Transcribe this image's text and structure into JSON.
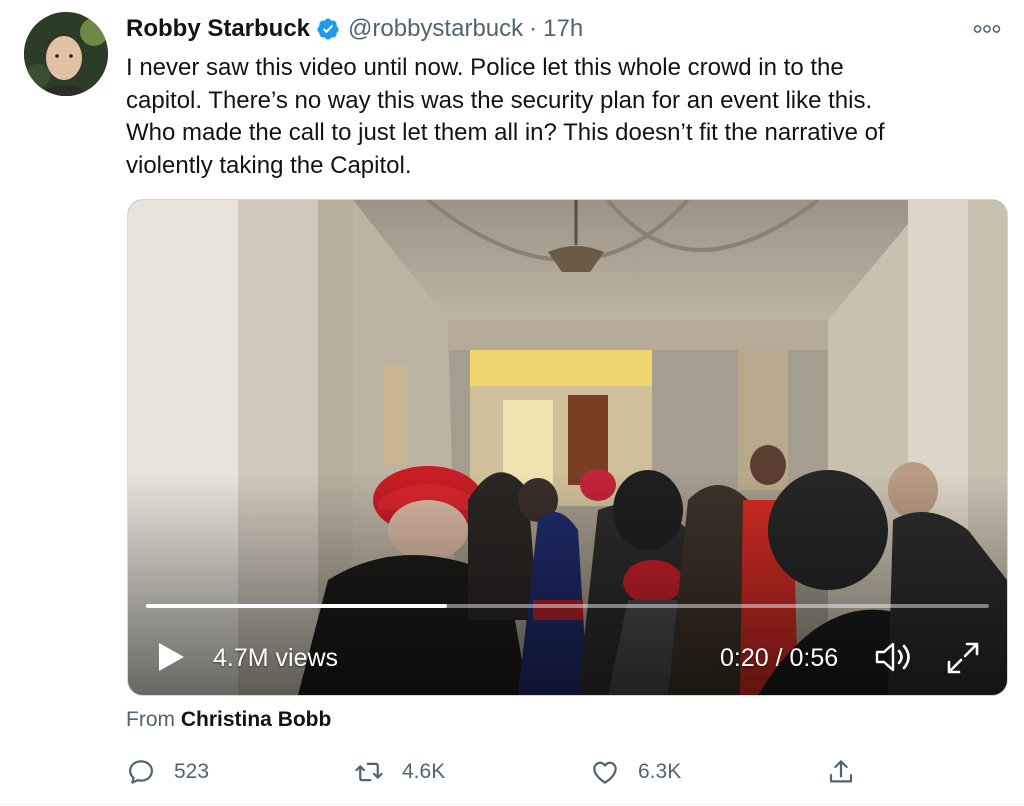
{
  "tweet": {
    "author": {
      "display_name": "Robby Starbuck",
      "handle": "@robbystarbuck",
      "verified": true,
      "avatar_icon": "profile-photo"
    },
    "separator": "·",
    "time": "17h",
    "more_icon": "more-options-icon",
    "text_lines": [
      "I never saw this video until now. Police let this whole crowd in to the",
      "capitol. There’s no way this was the security plan for an event like this.",
      "Who made the call to just let them all in? This doesn’t fit the narrative of",
      "violently taking the Capitol."
    ],
    "video": {
      "views": "4.7M views",
      "timecode": "0:20 / 0:56",
      "progress": 0.3571,
      "icons": [
        "play-icon",
        "volume-icon",
        "fullscreen-icon"
      ]
    },
    "source": {
      "prefix": "From",
      "name": "Christina Bobb"
    },
    "actions": {
      "reply_count": "523",
      "retweet_count": "4.6K",
      "like_count": "6.3K"
    },
    "colors": {
      "verified": "#1d9bf0",
      "secondary_text": "#536471",
      "primary_text": "#0f1419"
    }
  }
}
